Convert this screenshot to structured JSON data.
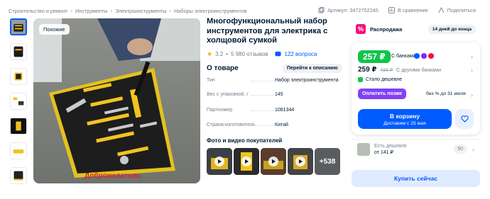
{
  "breadcrumbs": [
    "Строительство и ремонт",
    "Инструменты",
    "Электроинструменты",
    "Наборы электроинструментов"
  ],
  "meta": {
    "article": "Артикул: 3472752245",
    "compare": "В сравнение",
    "share": "Поделиться"
  },
  "gallery": {
    "similar_badge": "Похожие",
    "watermark": "Доброжелатель"
  },
  "product": {
    "title": "Многофункциональный набор инструментов для электрика с холщовой сумкой",
    "rating": "3.2",
    "reviews": "5 980 отзывов",
    "questions": "122 вопроса"
  },
  "about": {
    "heading": "О товаре",
    "description_button": "Перейти к описанию",
    "specs": [
      {
        "key": "Тип",
        "value": "Набор электроинструмента"
      },
      {
        "key": "Вес с упаковкой, г",
        "value": "145"
      },
      {
        "key": "Партномер",
        "value": "1081344"
      },
      {
        "key": "Страна-изготовитель",
        "value": "Китай"
      }
    ]
  },
  "media": {
    "heading": "Фото и видео покупателей",
    "more_count": "+538"
  },
  "sale": {
    "label": "Распродажа",
    "days_left": "14 дней до конца"
  },
  "pricing": {
    "bank_price": "257 ₽",
    "bank_label": "С банками",
    "other_price": "259 ₽",
    "old_price": "498 ₽",
    "other_label": "С другими банками",
    "cheaper_note": "Стало дешевле",
    "pay_later_button": "Оплатить позже",
    "pay_later_note": "без % до 31 июля",
    "cart_button": "В корзину",
    "delivery": "Доставим с 25 мая"
  },
  "cheaper_offer": {
    "label": "Есть дешевле",
    "price": "от 141 ₽",
    "count": "50"
  },
  "buy_now": "Купить сейчас",
  "colors": {
    "accent": "#005bff",
    "green": "#10c44c",
    "sale": "#f1117e",
    "purple": "#8042f3"
  }
}
